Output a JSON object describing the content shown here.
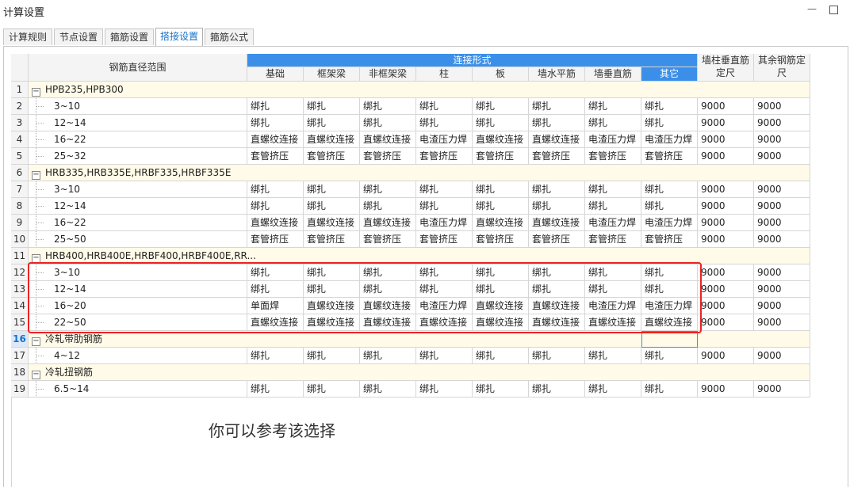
{
  "window": {
    "title": "计算设置"
  },
  "tabs": [
    {
      "label": "计算规则",
      "active": false
    },
    {
      "label": "节点设置",
      "active": false
    },
    {
      "label": "箍筋设置",
      "active": false
    },
    {
      "label": "搭接设置",
      "active": true
    },
    {
      "label": "箍筋公式",
      "active": false
    }
  ],
  "table": {
    "header": {
      "diameter_range": "钢筋直径范围",
      "connection_form": "连接形式",
      "columns": [
        "基础",
        "框架梁",
        "非框架梁",
        "柱",
        "板",
        "墙水平筋",
        "墙垂直筋",
        "其它"
      ],
      "selected_column": "其它",
      "wall_col_length_line1": "墙柱垂直筋",
      "wall_col_length_line2": "定尺",
      "other_length_line1": "其余钢筋定",
      "other_length_line2": "尺"
    },
    "rows": [
      {
        "num": "1",
        "group": true,
        "label": "HPB235,HPB300"
      },
      {
        "num": "2",
        "label": "3~10",
        "values": [
          "绑扎",
          "绑扎",
          "绑扎",
          "绑扎",
          "绑扎",
          "绑扎",
          "绑扎",
          "绑扎",
          "9000",
          "9000"
        ]
      },
      {
        "num": "3",
        "label": "12~14",
        "values": [
          "绑扎",
          "绑扎",
          "绑扎",
          "绑扎",
          "绑扎",
          "绑扎",
          "绑扎",
          "绑扎",
          "9000",
          "9000"
        ]
      },
      {
        "num": "4",
        "label": "16~22",
        "values": [
          "直螺纹连接",
          "直螺纹连接",
          "直螺纹连接",
          "电渣压力焊",
          "直螺纹连接",
          "直螺纹连接",
          "电渣压力焊",
          "电渣压力焊",
          "9000",
          "9000"
        ]
      },
      {
        "num": "5",
        "label": "25~32",
        "values": [
          "套管挤压",
          "套管挤压",
          "套管挤压",
          "套管挤压",
          "套管挤压",
          "套管挤压",
          "套管挤压",
          "套管挤压",
          "9000",
          "9000"
        ]
      },
      {
        "num": "6",
        "group": true,
        "label": "HRB335,HRB335E,HRBF335,HRBF335E"
      },
      {
        "num": "7",
        "label": "3~10",
        "values": [
          "绑扎",
          "绑扎",
          "绑扎",
          "绑扎",
          "绑扎",
          "绑扎",
          "绑扎",
          "绑扎",
          "9000",
          "9000"
        ]
      },
      {
        "num": "8",
        "label": "12~14",
        "values": [
          "绑扎",
          "绑扎",
          "绑扎",
          "绑扎",
          "绑扎",
          "绑扎",
          "绑扎",
          "绑扎",
          "9000",
          "9000"
        ]
      },
      {
        "num": "9",
        "label": "16~22",
        "values": [
          "直螺纹连接",
          "直螺纹连接",
          "直螺纹连接",
          "电渣压力焊",
          "直螺纹连接",
          "直螺纹连接",
          "电渣压力焊",
          "电渣压力焊",
          "9000",
          "9000"
        ]
      },
      {
        "num": "10",
        "label": "25~50",
        "values": [
          "套管挤压",
          "套管挤压",
          "套管挤压",
          "套管挤压",
          "套管挤压",
          "套管挤压",
          "套管挤压",
          "套管挤压",
          "9000",
          "9000"
        ]
      },
      {
        "num": "11",
        "group": true,
        "label": "HRB400,HRB400E,HRBF400,HRBF400E,RR..."
      },
      {
        "num": "12",
        "label": "3~10",
        "values": [
          "绑扎",
          "绑扎",
          "绑扎",
          "绑扎",
          "绑扎",
          "绑扎",
          "绑扎",
          "绑扎",
          "9000",
          "9000"
        ]
      },
      {
        "num": "13",
        "label": "12~14",
        "values": [
          "绑扎",
          "绑扎",
          "绑扎",
          "绑扎",
          "绑扎",
          "绑扎",
          "绑扎",
          "绑扎",
          "9000",
          "9000"
        ]
      },
      {
        "num": "14",
        "label": "16~20",
        "values": [
          "单面焊",
          "直螺纹连接",
          "直螺纹连接",
          "电渣压力焊",
          "直螺纹连接",
          "直螺纹连接",
          "电渣压力焊",
          "电渣压力焊",
          "9000",
          "9000"
        ]
      },
      {
        "num": "15",
        "label": "22~50",
        "values": [
          "直螺纹连接",
          "直螺纹连接",
          "直螺纹连接",
          "直螺纹连接",
          "直螺纹连接",
          "直螺纹连接",
          "直螺纹连接",
          "直螺纹连接",
          "9000",
          "9000"
        ]
      },
      {
        "num": "16",
        "group": true,
        "label": "冷轧带肋钢筋",
        "current": true
      },
      {
        "num": "17",
        "label": "4~12",
        "values": [
          "绑扎",
          "绑扎",
          "绑扎",
          "绑扎",
          "绑扎",
          "绑扎",
          "绑扎",
          "绑扎",
          "9000",
          "9000"
        ]
      },
      {
        "num": "18",
        "group": true,
        "label": "冷轧扭钢筋"
      },
      {
        "num": "19",
        "label": "6.5~14",
        "values": [
          "绑扎",
          "绑扎",
          "绑扎",
          "绑扎",
          "绑扎",
          "绑扎",
          "绑扎",
          "绑扎",
          "9000",
          "9000"
        ]
      }
    ]
  },
  "annotation": {
    "caption": "你可以参考该选择",
    "highlight_color": "#ee2222"
  },
  "colors": {
    "accent": "#3b8fe8",
    "group_row_bg": "#fffbe8"
  }
}
